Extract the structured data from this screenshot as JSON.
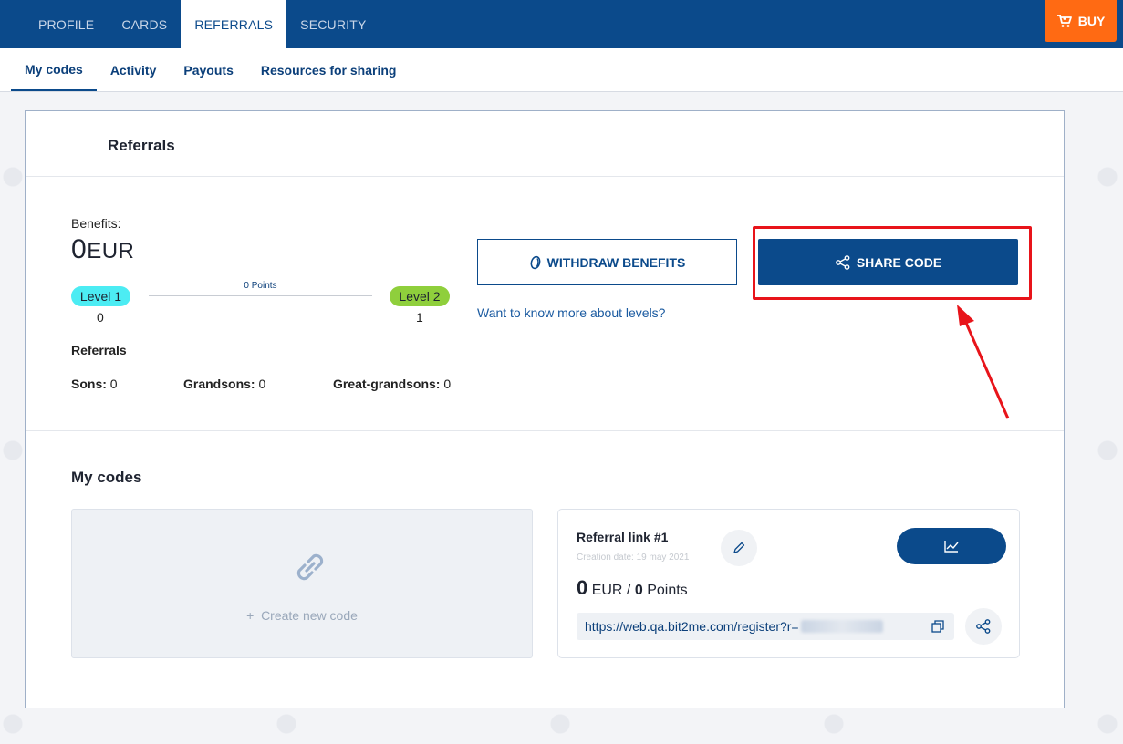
{
  "topnav": {
    "tabs": [
      "PROFILE",
      "CARDS",
      "REFERRALS",
      "SECURITY"
    ],
    "active_tab": "REFERRALS",
    "buy_label": "BUY"
  },
  "subnav": {
    "items": [
      "My codes",
      "Activity",
      "Payouts",
      "Resources for sharing"
    ],
    "active": "My codes"
  },
  "referrals_panel": {
    "title": "Referrals",
    "benefits_label": "Benefits:",
    "benefits_amount": "0",
    "benefits_currency": "EUR",
    "level_current_label": "Level 1",
    "level_current_value": "0",
    "level_next_label": "Level 2",
    "level_next_value": "1",
    "points_label": "0 Points",
    "referrals_heading": "Referrals",
    "stats": [
      {
        "label": "Sons:",
        "value": "0"
      },
      {
        "label": "Grandsons:",
        "value": "0"
      },
      {
        "label": "Great-grandsons:",
        "value": "0"
      }
    ],
    "withdraw_label": "WITHDRAW BENEFITS",
    "levels_link": "Want to know more about levels?",
    "share_label": "SHARE CODE"
  },
  "my_codes": {
    "heading": "My codes",
    "create_label": "Create new code",
    "card": {
      "title": "Referral link #1",
      "creation_date": "Creation date: 19 may 2021",
      "amount": "0",
      "amount_unit": "EUR /",
      "points": "0",
      "points_unit": "Points",
      "url": "https://web.qa.bit2me.com/register?r="
    }
  },
  "colors": {
    "brand": "#0b4a8b",
    "buy": "#ff6a13",
    "level1": "#4cecf3",
    "level2": "#8fcf3c",
    "highlight": "#e8141a"
  },
  "icons": {
    "buy": "cart-icon",
    "withdraw": "coin-icon",
    "share": "share-icon",
    "create": "link-icon",
    "edit": "pencil-icon",
    "stats": "chart-line-icon",
    "copy": "copy-icon"
  }
}
